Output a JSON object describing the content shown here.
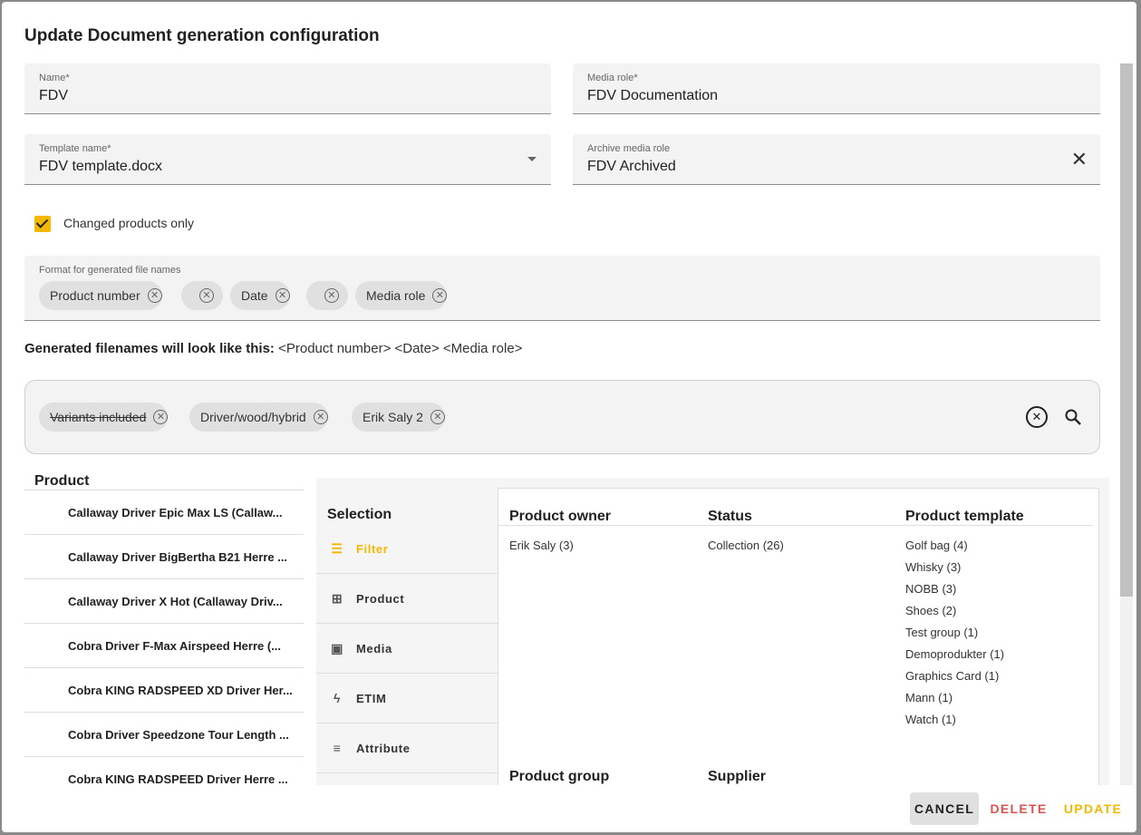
{
  "dialog": {
    "title": "Update Document generation configuration"
  },
  "fields": {
    "name": {
      "label": "Name",
      "required": "*",
      "value": "FDV"
    },
    "media_role": {
      "label": "Media role",
      "required": "*",
      "value": "FDV Documentation"
    },
    "template_name": {
      "label": "Template name",
      "required": "*",
      "value": "FDV template.docx"
    },
    "archive_media_role": {
      "label": "Archive media role",
      "value": "FDV Archived"
    }
  },
  "changed_products_only": {
    "label": "Changed products only",
    "checked": true
  },
  "file_name_format": {
    "label": "Format for generated file names",
    "chips": [
      "Product number",
      "",
      "Date",
      "",
      "Media role"
    ]
  },
  "preview": {
    "label": "Generated filenames will look like this:",
    "value": "<Product number> <Date> <Media role>"
  },
  "search": {
    "chips": [
      "Variants included",
      "Driver/wood/hybrid",
      "Erik Saly 2"
    ]
  },
  "product_list": {
    "heading": "Product",
    "items": [
      "Callaway Driver Epic Max LS  (Callaw...",
      "Callaway Driver BigBertha B21 Herre  ...",
      "Callaway Driver X Hot  (Callaway Driv...",
      "Cobra Driver F-Max Airspeed Herre  (...",
      "Cobra KING RADSPEED XD Driver Her...",
      "Cobra Driver Speedzone Tour Length ...",
      "Cobra KING RADSPEED Driver Herre  ..."
    ]
  },
  "selection": {
    "heading": "Selection",
    "menu": [
      {
        "label": "Filter",
        "icon": "tune-icon",
        "glyph": "☰"
      },
      {
        "label": "Product",
        "icon": "widgets-icon",
        "glyph": "⊞"
      },
      {
        "label": "Media",
        "icon": "photo-library-icon",
        "glyph": "▣"
      },
      {
        "label": "ETIM",
        "icon": "bolt-icon",
        "glyph": "ϟ"
      },
      {
        "label": "Attribute",
        "icon": "list-icon",
        "glyph": "≡"
      }
    ]
  },
  "facets": {
    "product_owner": {
      "title": "Product owner",
      "values": [
        "Erik Saly (3)"
      ]
    },
    "status": {
      "title": "Status",
      "values": [
        "Collection (26)"
      ]
    },
    "product_template": {
      "title": "Product template",
      "values": [
        "Golf bag (4)",
        "Whisky (3)",
        "NOBB (3)",
        "Shoes (2)",
        "Test group (1)",
        "Demoprodukter (1)",
        "Graphics Card (1)",
        "Mann (1)",
        "Watch (1)"
      ]
    },
    "product_group": {
      "title": "Product group"
    },
    "supplier": {
      "title": "Supplier"
    }
  },
  "footer": {
    "cancel": "CANCEL",
    "delete": "DELETE",
    "update": "UPDATE"
  },
  "colors": {
    "accent": "#f5b800",
    "danger": "#d9534f"
  }
}
